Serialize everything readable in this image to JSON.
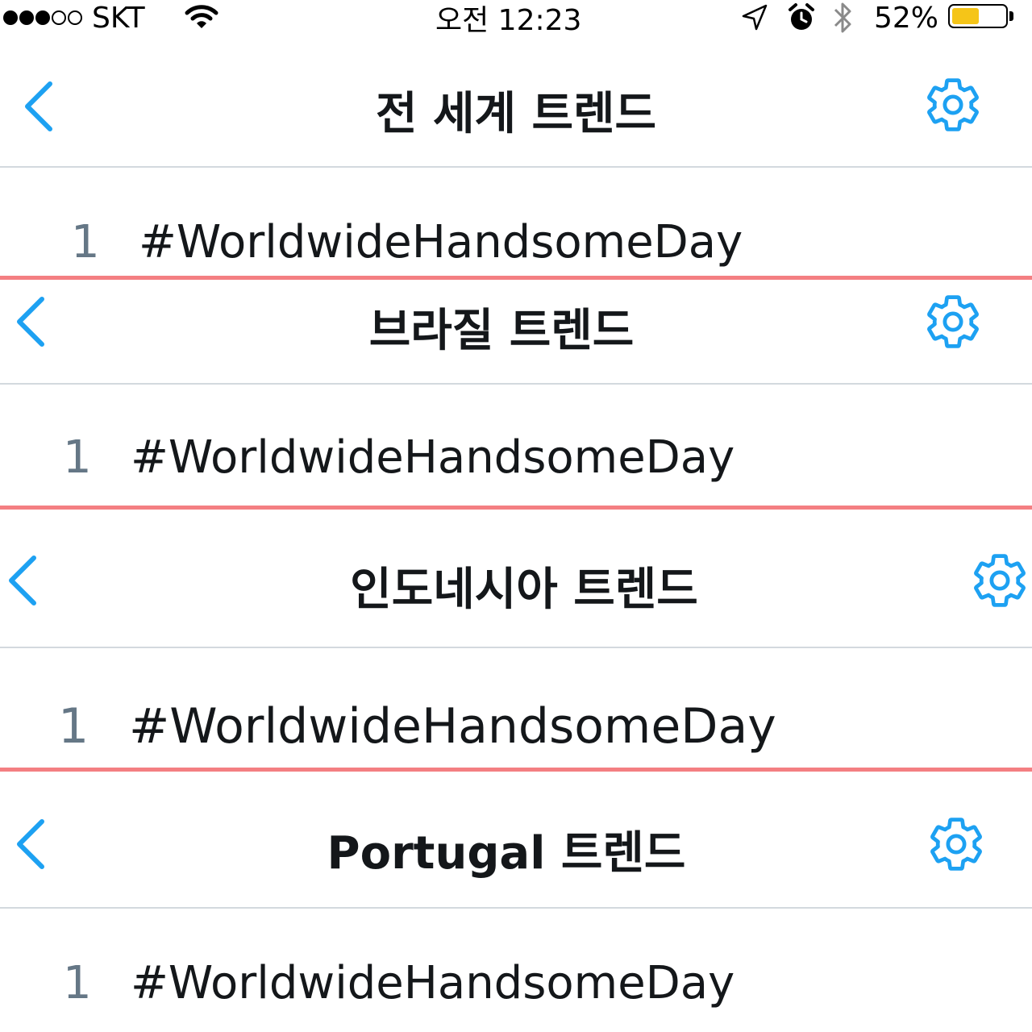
{
  "status_bar": {
    "carrier": "SKT",
    "time": "오전 12:23",
    "battery_text": "52%",
    "battery_level": 0.52,
    "signal_bars": 3,
    "signal_total": 5
  },
  "accent_color": "#1da1f2",
  "separator_color": "#f47f82",
  "panels": [
    {
      "title": "전 세계 트렌드",
      "rank": "1",
      "trend": "#WorldwideHandsomeDay"
    },
    {
      "title": "브라질 트렌드",
      "rank": "1",
      "trend": "#WorldwideHandsomeDay"
    },
    {
      "title": "인도네시아 트렌드",
      "rank": "1",
      "trend": "#WorldwideHandsomeDay"
    },
    {
      "title": "Portugal 트렌드",
      "rank": "1",
      "trend": "#WorldwideHandsomeDay"
    }
  ]
}
